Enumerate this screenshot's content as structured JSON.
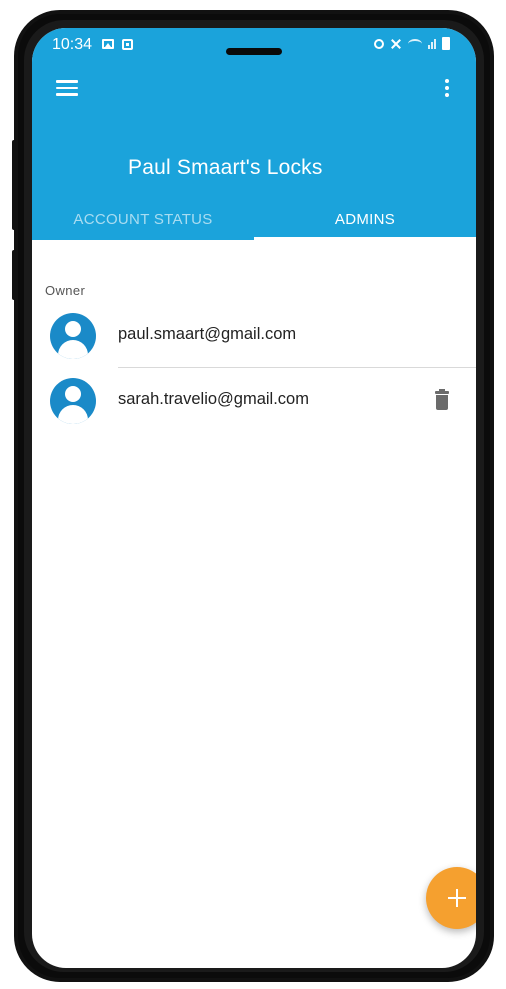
{
  "status_bar": {
    "time": "10:34",
    "icons": [
      "image-icon",
      "notification-square-icon",
      "alarm-icon",
      "mute-icon",
      "wifi-icon",
      "signal-icon",
      "battery-icon"
    ]
  },
  "app_bar": {
    "title": "Paul Smaart's Locks",
    "background_color": "#1ba3db",
    "menu_icon": "hamburger-menu-icon",
    "overflow_icon": "more-vertical-icon"
  },
  "tabs": [
    {
      "label": "ACCOUNT STATUS",
      "active": false
    },
    {
      "label": "ADMINS",
      "active": true
    }
  ],
  "admins_section": {
    "header": "Owner",
    "admins": [
      {
        "email": "paul.smaart@gmail.com",
        "avatar_icon": "account-circle-icon",
        "deletable": false
      },
      {
        "email": "sarah.travelio@gmail.com",
        "avatar_icon": "account-circle-icon",
        "deletable": true,
        "action_icon": "trash-icon"
      }
    ]
  },
  "fab": {
    "icon": "plus-icon",
    "color": "#f5a02f"
  }
}
